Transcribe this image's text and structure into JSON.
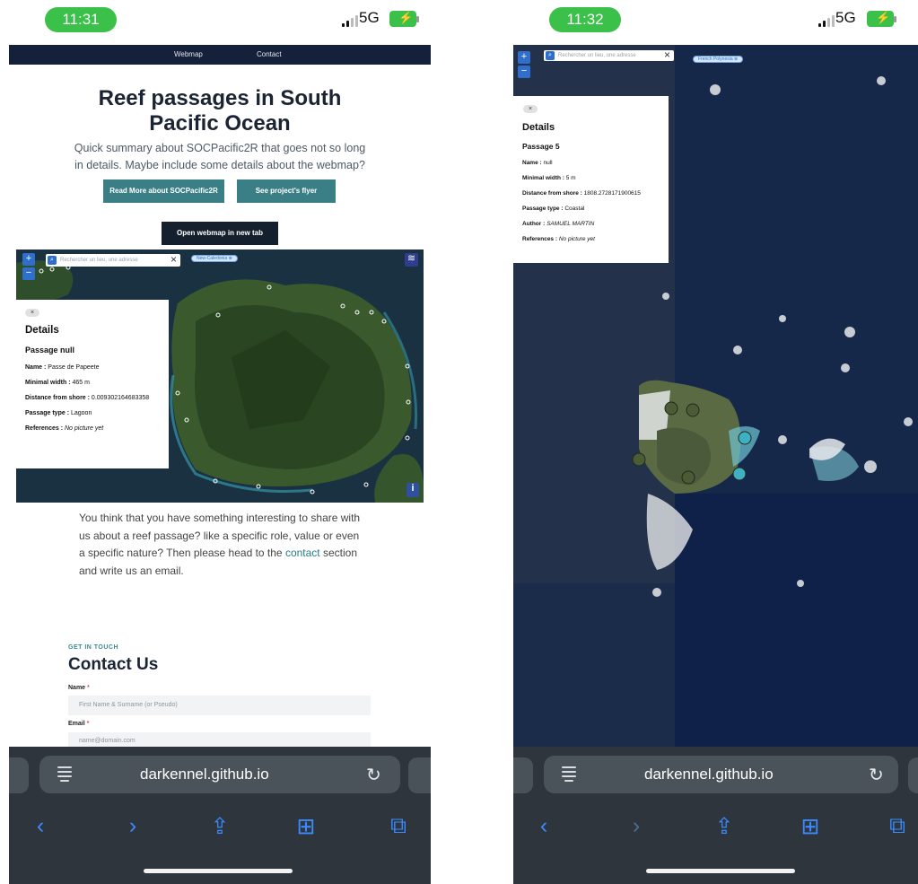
{
  "left": {
    "status": {
      "time": "11:31",
      "network": "5G"
    },
    "nav": {
      "webmap": "Webmap",
      "contact": "Contact"
    },
    "hero": {
      "title": "Reef passages in South Pacific Ocean",
      "subtitle": "Quick summary about SOCPacific2R that goes not so long in details. Maybe include some details about the webmap?",
      "read_more": "Read More about SOCPacific2R",
      "flyer": "See project's flyer",
      "open_webmap": "Open webmap in new tab"
    },
    "map": {
      "zoom_in": "+",
      "zoom_out": "−",
      "search_placeholder": "Rechercher un lieu, une adresse",
      "region_chip": "New-Caledonia ⊗",
      "details": {
        "close": "×",
        "title": "Details",
        "passage": "Passage null",
        "rows": [
          {
            "label": "Name :",
            "value": "Passe de Papeete"
          },
          {
            "label": "Minimal width :",
            "value": "465 m"
          },
          {
            "label": "Distance from shore :",
            "value": "0.009302164683358"
          },
          {
            "label": "Passage type :",
            "value": "Lagoon"
          },
          {
            "label": "References :",
            "value": "No picture yet"
          }
        ]
      },
      "info_button": "i"
    },
    "share": {
      "text_before": "You think that you have something interesting to share with us about a reef passage? like a specific role, value or even a specific nature? Then please head to the ",
      "link": "contact",
      "text_after": " section and write us an email."
    },
    "contact": {
      "kicker": "GET IN TOUCH",
      "title": "Contact Us",
      "name_label": "Name",
      "name_placeholder": "First Name & Surname (or Pseudo)",
      "email_label": "Email",
      "email_placeholder": "name@domain.com",
      "required_mark": "*"
    },
    "browser": {
      "url": "darkennel.github.io"
    }
  },
  "right": {
    "status": {
      "time": "11:32",
      "network": "5G"
    },
    "map": {
      "zoom_in": "+",
      "zoom_out": "−",
      "search_placeholder": "Rechercher un lieu, une adresse",
      "region_chip": "French Polynesia ⊗",
      "details": {
        "close": "×",
        "title": "Details",
        "passage": "Passage 5",
        "rows": [
          {
            "label": "Name :",
            "value": "null"
          },
          {
            "label": "Minimal width :",
            "value": "5 m"
          },
          {
            "label": "Distance from shore :",
            "value": "1808.2728171900615"
          },
          {
            "label": "Passage type :",
            "value": "Coastal"
          },
          {
            "label": "Author :",
            "value": "SAMUEL MARTIN"
          },
          {
            "label": "References :",
            "value": "No picture yet"
          }
        ]
      }
    },
    "browser": {
      "url": "darkennel.github.io"
    }
  },
  "icons": {
    "back": "‹",
    "forward": "›",
    "share": "⇪",
    "bookmarks": "⊞",
    "tabs": "⧉",
    "reload": "↻",
    "search": "⌕",
    "layers": "≋",
    "bolt": "⚡"
  },
  "colors": {
    "time_pill": "#3bc14a",
    "nav_bg": "#15203a",
    "teal_button": "#3a7f86",
    "dark_button": "#14202d",
    "map_control": "#2f6fcb",
    "browser_bar": "#2e353c",
    "browser_accent": "#3b8bff"
  }
}
